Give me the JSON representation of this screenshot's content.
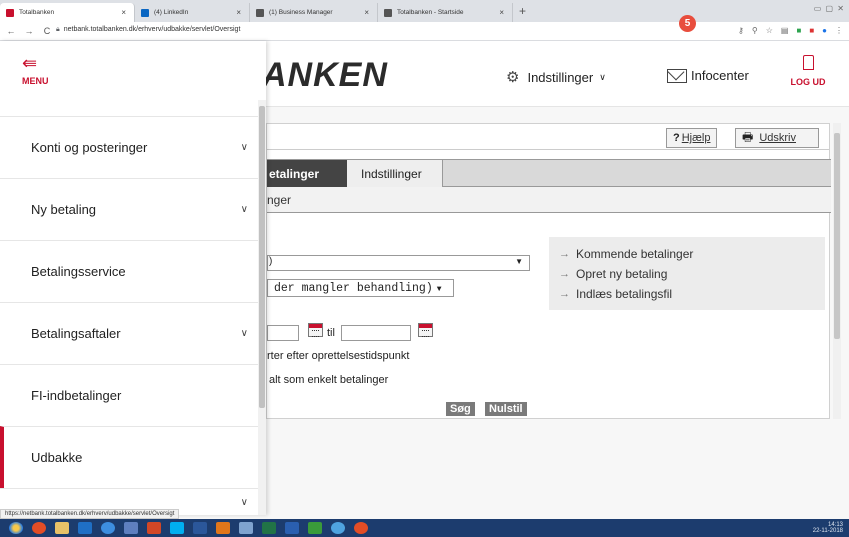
{
  "browser": {
    "tabs": [
      {
        "label": "Totalbanken",
        "active": true,
        "color": "#c8102e"
      },
      {
        "label": "(4) LinkedIn",
        "active": false,
        "color": "#0a66c2"
      },
      {
        "label": "(1) Business Manager",
        "active": false,
        "color": "#555555"
      },
      {
        "label": "Totalbanken - Startside",
        "active": false,
        "color": "#555555"
      }
    ],
    "new_tab": "+",
    "url": "netbank.totalbanken.dk/erhverv/udbakke/servlet/Oversigt",
    "status_url": "https://netbank.totalbanken.dk/erhverv/udbakke/servlet/Oversigt"
  },
  "header": {
    "logo_text": "ANKEN",
    "settings_label": "Indstillinger",
    "infocenter_label": "Infocenter",
    "infocenter_badge": "5",
    "logout_label": "LOG UD"
  },
  "sidebar": {
    "menu_label": "MENU",
    "items": [
      {
        "label": "Konti og posteringer",
        "has_chevron": true
      },
      {
        "label": "Ny betaling",
        "has_chevron": true
      },
      {
        "label": "Betalingsservice",
        "has_chevron": false
      },
      {
        "label": "Betalingsaftaler",
        "has_chevron": true
      },
      {
        "label": "FI-indbetalinger",
        "has_chevron": false
      },
      {
        "label": "Udbakke",
        "has_chevron": false,
        "active": true
      }
    ]
  },
  "panel": {
    "help_label": "Hjælp",
    "print_label": "Udskriv",
    "tab_active": "etalinger",
    "tab_other": "Indstillinger",
    "subnav": "nger",
    "select1_value": ")",
    "select2_value": " der mangler behandling)",
    "date_separator": "til",
    "sort_text": "rter efter oprettelsestidspunkt",
    "all_text": "alt som enkelt betalinger",
    "search_button": "Søg",
    "reset_button": "Nulstil"
  },
  "links": [
    "Kommende betalinger",
    "Opret ny betaling",
    "Indlæs betalingsfil"
  ],
  "taskbar": {
    "time": "14:13",
    "date": "22-11-2018"
  },
  "colors": {
    "brand_red": "#c8102e",
    "taskbar_blue": "#1c3c6e"
  }
}
